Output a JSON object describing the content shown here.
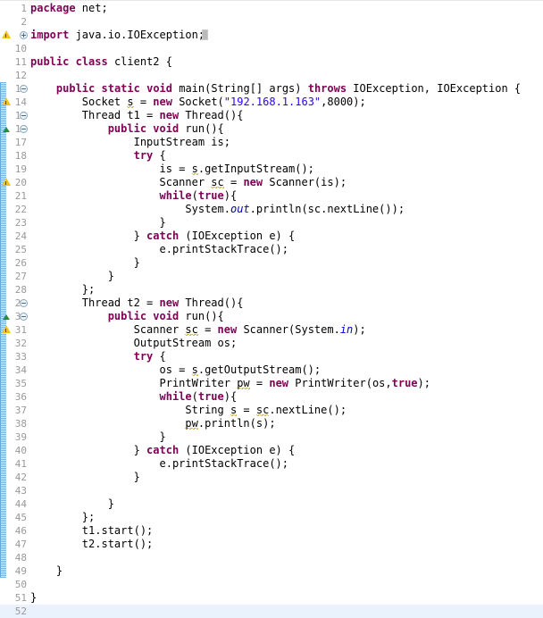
{
  "editor": {
    "kind": "java-source-editor",
    "language": "Java",
    "first_line": 1,
    "last_line": 52,
    "current_line": 52,
    "change_bar_range": [
      13,
      49
    ],
    "colors": {
      "background": "#ffffff",
      "keyword": "#7f0055",
      "string": "#2a00ff",
      "field": "#0000c0",
      "line_number": "#999999",
      "current_line_highlight": "#eaf2fd",
      "change_bar": "#7ab8e6",
      "warning_icon": "#f0c419",
      "override_icon": "#2f8a3b"
    }
  },
  "lines": [
    {
      "n": "1",
      "indent": 0,
      "text": "package net;",
      "tokens": [
        {
          "t": "package",
          "c": "kw"
        },
        {
          "t": " net;",
          "c": ""
        }
      ]
    },
    {
      "n": "2",
      "indent": 0,
      "text": "",
      "tokens": []
    },
    {
      "n": "3",
      "indent": 0,
      "text": "import java.io.IOException;",
      "tokens": [
        {
          "t": "import",
          "c": "kw"
        },
        {
          "t": " java.io.IOException;",
          "c": ""
        }
      ],
      "fold": "plus",
      "marker": "warning"
    },
    {
      "n": "10",
      "indent": 0,
      "text": "",
      "tokens": []
    },
    {
      "n": "11",
      "indent": 0,
      "text": "public class client2 {",
      "tokens": [
        {
          "t": "public",
          "c": "kw"
        },
        {
          "t": " ",
          "c": ""
        },
        {
          "t": "class",
          "c": "kw"
        },
        {
          "t": " client2 {",
          "c": ""
        }
      ]
    },
    {
      "n": "12",
      "indent": 0,
      "text": "",
      "tokens": []
    },
    {
      "n": "13",
      "indent": 1,
      "text": "public static void main(String[] args) throws IOException, IOException {",
      "tokens": [
        {
          "t": "public",
          "c": "kw"
        },
        {
          "t": " ",
          "c": ""
        },
        {
          "t": "static",
          "c": "kw"
        },
        {
          "t": " ",
          "c": ""
        },
        {
          "t": "void",
          "c": "kw"
        },
        {
          "t": " main(String[] args) ",
          "c": ""
        },
        {
          "t": "throws",
          "c": "kw"
        },
        {
          "t": " IOException, IOException {",
          "c": ""
        }
      ],
      "fold": "minus"
    },
    {
      "n": "14",
      "indent": 2,
      "text": "Socket s = new Socket(\"192.168.1.163\",8000);",
      "tokens": [
        {
          "t": "Socket ",
          "c": ""
        },
        {
          "t": "s",
          "c": "sqr"
        },
        {
          "t": " = ",
          "c": ""
        },
        {
          "t": "new",
          "c": "kw"
        },
        {
          "t": " Socket(",
          "c": ""
        },
        {
          "t": "\"192.168.1.163\"",
          "c": "str"
        },
        {
          "t": ",8000);",
          "c": ""
        }
      ],
      "marker": "warning"
    },
    {
      "n": "15",
      "indent": 2,
      "text": "Thread t1 = new Thread(){",
      "tokens": [
        {
          "t": "Thread t1 = ",
          "c": ""
        },
        {
          "t": "new",
          "c": "kw"
        },
        {
          "t": " Thread(){",
          "c": ""
        }
      ],
      "fold": "minus"
    },
    {
      "n": "16",
      "indent": 3,
      "text": "public void run(){",
      "tokens": [
        {
          "t": "public",
          "c": "kw"
        },
        {
          "t": " ",
          "c": ""
        },
        {
          "t": "void",
          "c": "kw"
        },
        {
          "t": " run(){",
          "c": ""
        }
      ],
      "fold": "minus",
      "marker": "override"
    },
    {
      "n": "17",
      "indent": 4,
      "text": "InputStream is;",
      "tokens": [
        {
          "t": "InputStream is;",
          "c": ""
        }
      ]
    },
    {
      "n": "18",
      "indent": 4,
      "text": "try {",
      "tokens": [
        {
          "t": "try",
          "c": "kw"
        },
        {
          "t": " {",
          "c": ""
        }
      ]
    },
    {
      "n": "19",
      "indent": 5,
      "text": "is = s.getInputStream();",
      "tokens": [
        {
          "t": "is = ",
          "c": ""
        },
        {
          "t": "s",
          "c": "sqr"
        },
        {
          "t": ".getInputStream();",
          "c": ""
        }
      ]
    },
    {
      "n": "20",
      "indent": 5,
      "text": "Scanner sc = new Scanner(is);",
      "tokens": [
        {
          "t": "Scanner ",
          "c": ""
        },
        {
          "t": "sc",
          "c": "sqr"
        },
        {
          "t": " = ",
          "c": ""
        },
        {
          "t": "new",
          "c": "kw"
        },
        {
          "t": " Scanner(is);",
          "c": ""
        }
      ],
      "marker": "warning"
    },
    {
      "n": "21",
      "indent": 5,
      "text": "while(true){",
      "tokens": [
        {
          "t": "while",
          "c": "kw"
        },
        {
          "t": "(",
          "c": ""
        },
        {
          "t": "true",
          "c": "kw"
        },
        {
          "t": "){",
          "c": ""
        }
      ]
    },
    {
      "n": "22",
      "indent": 6,
      "text": "System.out.println(sc.nextLine());",
      "tokens": [
        {
          "t": "System.",
          "c": ""
        },
        {
          "t": "out",
          "c": "fld"
        },
        {
          "t": ".println(sc.nextLine());",
          "c": ""
        }
      ]
    },
    {
      "n": "23",
      "indent": 5,
      "text": "}",
      "tokens": [
        {
          "t": "}",
          "c": ""
        }
      ]
    },
    {
      "n": "24",
      "indent": 4,
      "text": "} catch (IOException e) {",
      "tokens": [
        {
          "t": "} ",
          "c": ""
        },
        {
          "t": "catch",
          "c": "kw"
        },
        {
          "t": " (IOException e) {",
          "c": ""
        }
      ]
    },
    {
      "n": "25",
      "indent": 5,
      "text": "e.printStackTrace();",
      "tokens": [
        {
          "t": "e.printStackTrace();",
          "c": ""
        }
      ]
    },
    {
      "n": "26",
      "indent": 4,
      "text": "}",
      "tokens": [
        {
          "t": "}",
          "c": ""
        }
      ]
    },
    {
      "n": "27",
      "indent": 3,
      "text": "}",
      "tokens": [
        {
          "t": "}",
          "c": ""
        }
      ]
    },
    {
      "n": "28",
      "indent": 2,
      "text": "};",
      "tokens": [
        {
          "t": "};",
          "c": ""
        }
      ]
    },
    {
      "n": "29",
      "indent": 2,
      "text": "Thread t2 = new Thread(){",
      "tokens": [
        {
          "t": "Thread t2 = ",
          "c": ""
        },
        {
          "t": "new",
          "c": "kw"
        },
        {
          "t": " Thread(){",
          "c": ""
        }
      ],
      "fold": "minus"
    },
    {
      "n": "30",
      "indent": 3,
      "text": "public void run(){",
      "tokens": [
        {
          "t": "public",
          "c": "kw"
        },
        {
          "t": " ",
          "c": ""
        },
        {
          "t": "void",
          "c": "kw"
        },
        {
          "t": " run(){",
          "c": ""
        }
      ],
      "fold": "minus",
      "marker": "override"
    },
    {
      "n": "31",
      "indent": 4,
      "text": "Scanner sc = new Scanner(System.in);",
      "tokens": [
        {
          "t": "Scanner ",
          "c": ""
        },
        {
          "t": "sc",
          "c": "sqr"
        },
        {
          "t": " = ",
          "c": ""
        },
        {
          "t": "new",
          "c": "kw"
        },
        {
          "t": " Scanner(System.",
          "c": ""
        },
        {
          "t": "in",
          "c": "fld"
        },
        {
          "t": ");",
          "c": ""
        }
      ],
      "marker": "warning"
    },
    {
      "n": "32",
      "indent": 4,
      "text": "OutputStream os;",
      "tokens": [
        {
          "t": "OutputStream os;",
          "c": ""
        }
      ]
    },
    {
      "n": "33",
      "indent": 4,
      "text": "try {",
      "tokens": [
        {
          "t": "try",
          "c": "kw"
        },
        {
          "t": " {",
          "c": ""
        }
      ]
    },
    {
      "n": "34",
      "indent": 5,
      "text": "os = s.getOutputStream();",
      "tokens": [
        {
          "t": "os = ",
          "c": ""
        },
        {
          "t": "s",
          "c": "sqr"
        },
        {
          "t": ".getOutputStream();",
          "c": ""
        }
      ]
    },
    {
      "n": "35",
      "indent": 5,
      "text": "PrintWriter pw = new PrintWriter(os,true);",
      "tokens": [
        {
          "t": "PrintWriter ",
          "c": ""
        },
        {
          "t": "pw",
          "c": "sqr"
        },
        {
          "t": " = ",
          "c": ""
        },
        {
          "t": "new",
          "c": "kw"
        },
        {
          "t": " PrintWriter(os,",
          "c": ""
        },
        {
          "t": "true",
          "c": "kw"
        },
        {
          "t": ");",
          "c": ""
        }
      ]
    },
    {
      "n": "36",
      "indent": 5,
      "text": "while(true){",
      "tokens": [
        {
          "t": "while",
          "c": "kw"
        },
        {
          "t": "(",
          "c": ""
        },
        {
          "t": "true",
          "c": "kw"
        },
        {
          "t": "){",
          "c": ""
        }
      ]
    },
    {
      "n": "37",
      "indent": 6,
      "text": "String s = sc.nextLine();",
      "tokens": [
        {
          "t": "String ",
          "c": ""
        },
        {
          "t": "s",
          "c": "sqr"
        },
        {
          "t": " = ",
          "c": ""
        },
        {
          "t": "sc",
          "c": "sqr"
        },
        {
          "t": ".nextLine();",
          "c": ""
        }
      ]
    },
    {
      "n": "38",
      "indent": 6,
      "text": "pw.println(s);",
      "tokens": [
        {
          "t": "pw",
          "c": "sqr"
        },
        {
          "t": ".println(s);",
          "c": ""
        }
      ]
    },
    {
      "n": "39",
      "indent": 5,
      "text": "}",
      "tokens": [
        {
          "t": "}",
          "c": ""
        }
      ]
    },
    {
      "n": "40",
      "indent": 4,
      "text": "} catch (IOException e) {",
      "tokens": [
        {
          "t": "} ",
          "c": ""
        },
        {
          "t": "catch",
          "c": "kw"
        },
        {
          "t": " (IOException e) {",
          "c": ""
        }
      ]
    },
    {
      "n": "41",
      "indent": 5,
      "text": "e.printStackTrace();",
      "tokens": [
        {
          "t": "e.printStackTrace();",
          "c": ""
        }
      ]
    },
    {
      "n": "42",
      "indent": 4,
      "text": "}",
      "tokens": [
        {
          "t": "}",
          "c": ""
        }
      ]
    },
    {
      "n": "43",
      "indent": 0,
      "text": "",
      "tokens": []
    },
    {
      "n": "44",
      "indent": 3,
      "text": "}",
      "tokens": [
        {
          "t": "}",
          "c": ""
        }
      ]
    },
    {
      "n": "45",
      "indent": 2,
      "text": "};",
      "tokens": [
        {
          "t": "};",
          "c": ""
        }
      ]
    },
    {
      "n": "46",
      "indent": 2,
      "text": "t1.start();",
      "tokens": [
        {
          "t": "t1.start();",
          "c": ""
        }
      ]
    },
    {
      "n": "47",
      "indent": 2,
      "text": "t2.start();",
      "tokens": [
        {
          "t": "t2.start();",
          "c": ""
        }
      ]
    },
    {
      "n": "48",
      "indent": 0,
      "text": "",
      "tokens": []
    },
    {
      "n": "49",
      "indent": 1,
      "text": "}",
      "tokens": [
        {
          "t": "}",
          "c": ""
        }
      ]
    },
    {
      "n": "50",
      "indent": 0,
      "text": "",
      "tokens": []
    },
    {
      "n": "51",
      "indent": 0,
      "text": "}",
      "tokens": [
        {
          "t": "}",
          "c": ""
        }
      ]
    },
    {
      "n": "52",
      "indent": 0,
      "text": "",
      "tokens": []
    }
  ]
}
